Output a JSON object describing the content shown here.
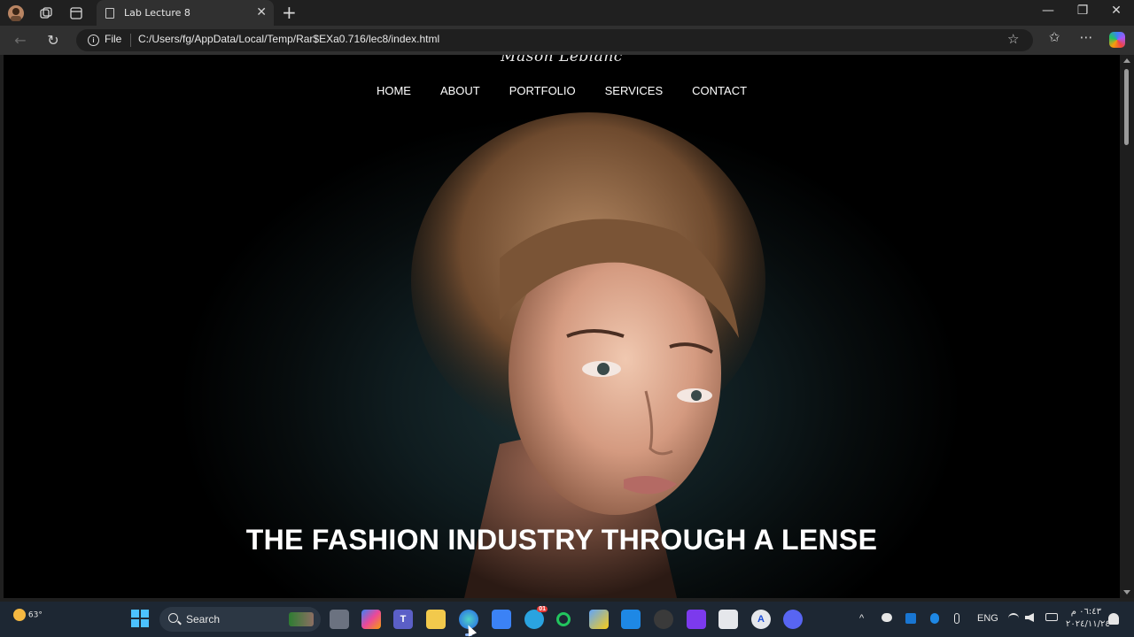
{
  "browser": {
    "tab_title": "Lab Lecture 8",
    "tab_close": "✕",
    "new_tab": "+",
    "file_label": "File",
    "url": "C:/Users/fg/AppData/Local/Temp/Rar$EXa0.716/lec8/index.html",
    "window_controls": {
      "minimize": "—",
      "maximize": "❐",
      "close": "✕"
    }
  },
  "page": {
    "logo_text": "Mason Leblanc",
    "nav": [
      "HOME",
      "ABOUT",
      "PORTFOLIO",
      "SERVICES",
      "CONTACT"
    ],
    "hero_title": "THE FASHION INDUSTRY THROUGH A LENSE"
  },
  "taskbar": {
    "weather_temp": "63°",
    "search_placeholder": "Search",
    "language": "ENG",
    "time": "٠٦:٤٣ م",
    "date": "٢٠٢٤/١١/٢٤",
    "telegram_badge": "01"
  },
  "colors": {
    "page_background": "#000000",
    "nav_text": "#ffffff",
    "taskbar": "#1d2733"
  }
}
